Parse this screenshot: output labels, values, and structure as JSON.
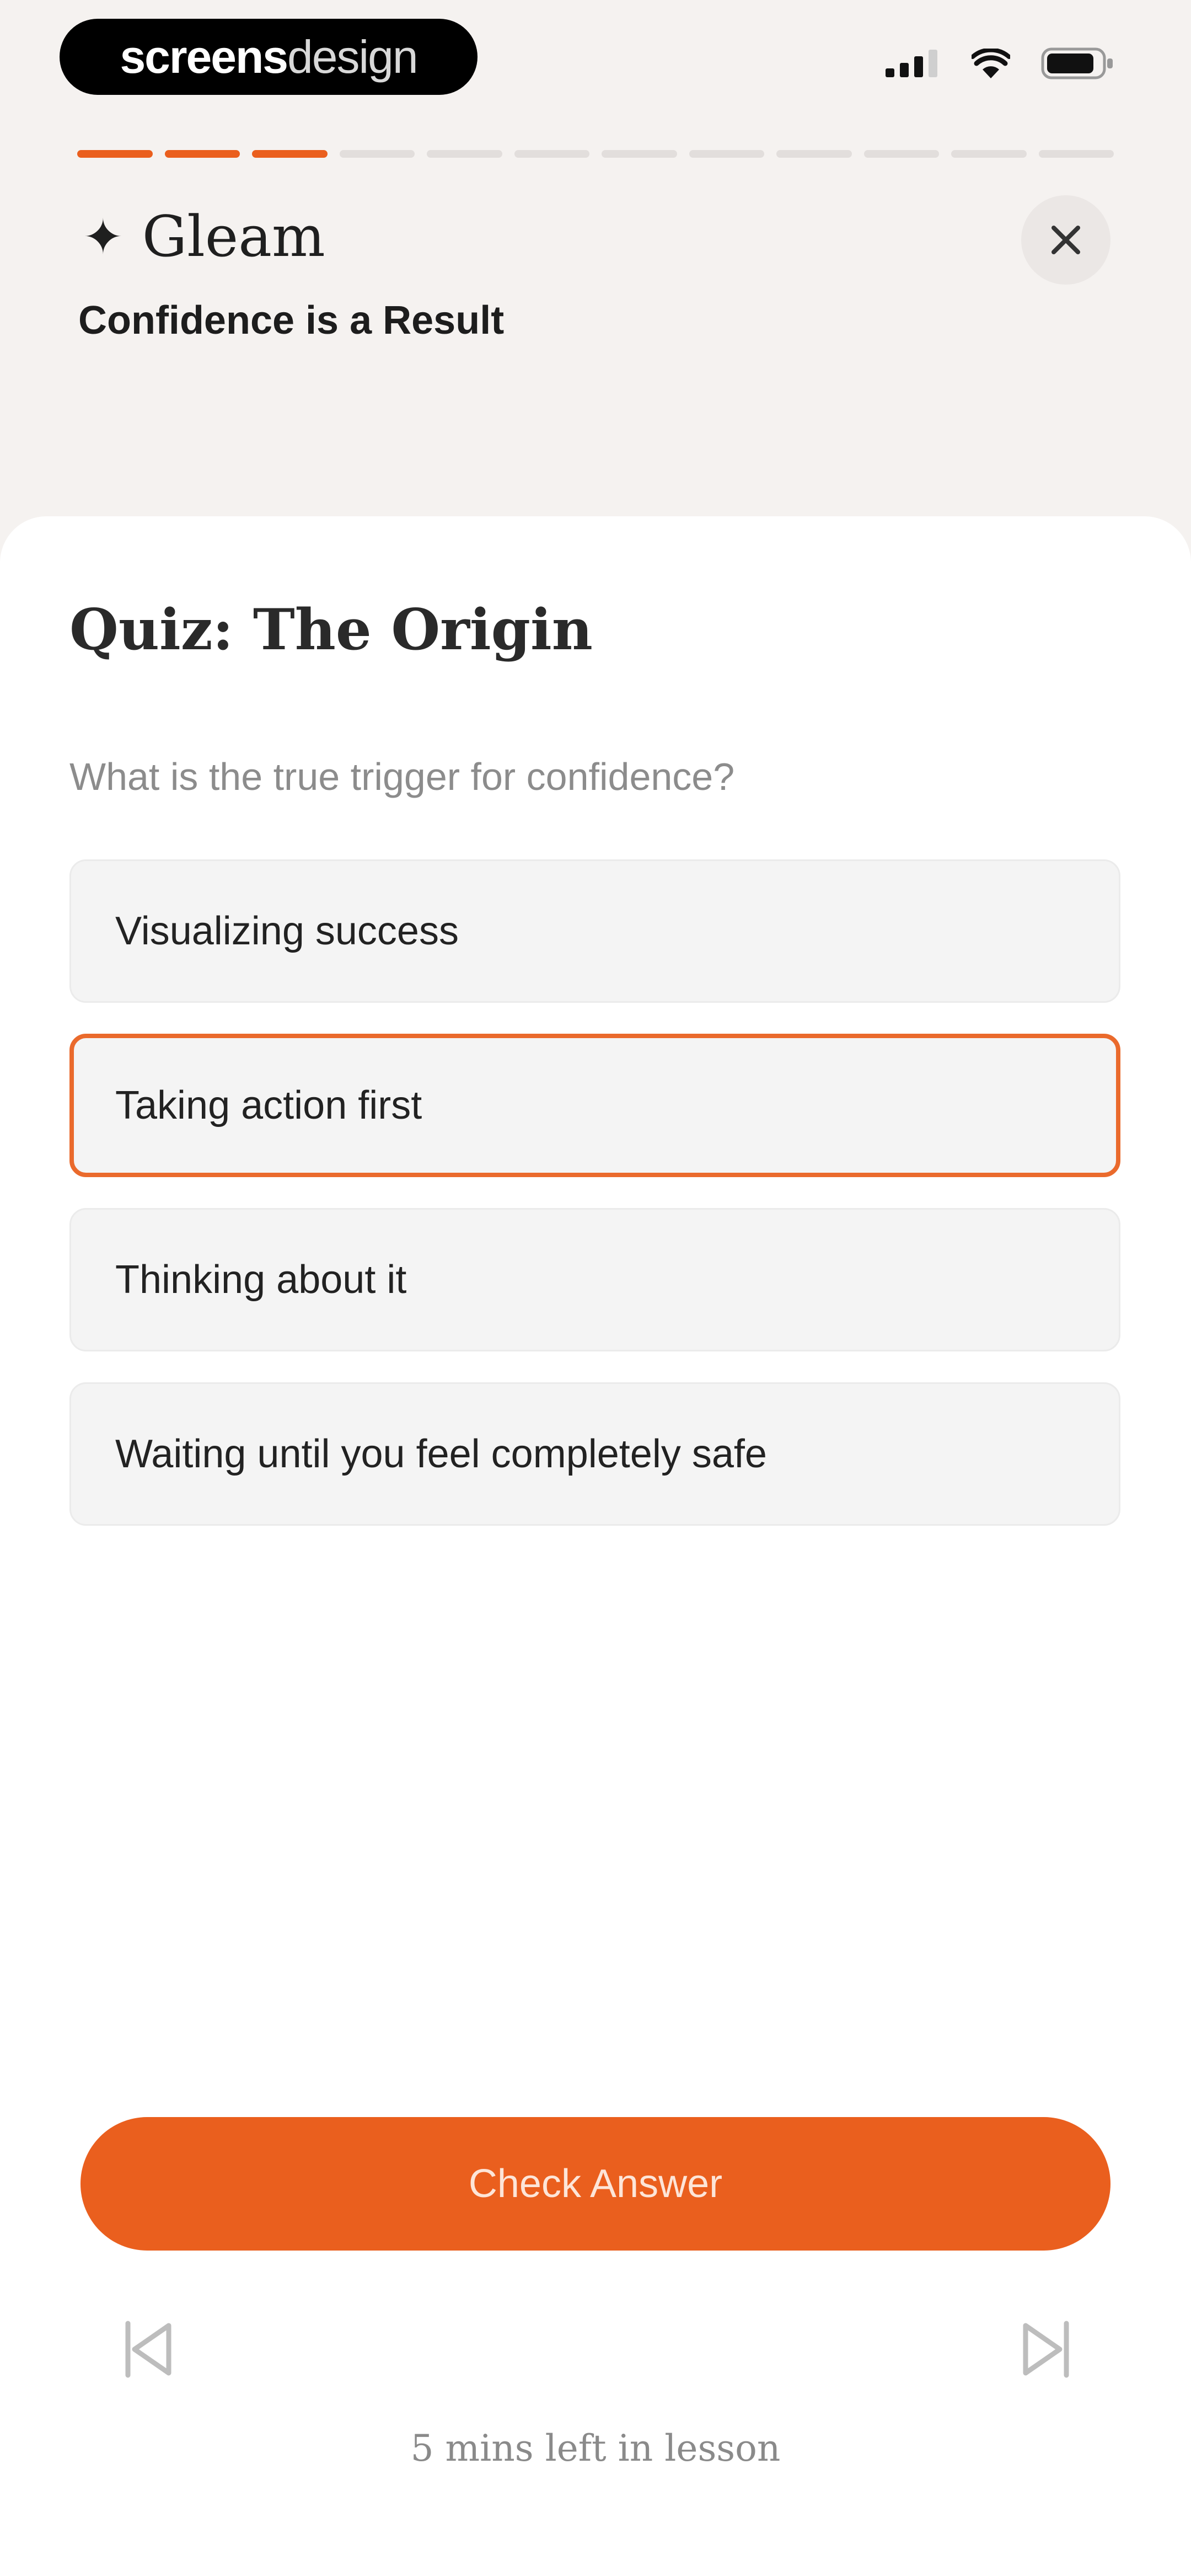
{
  "status_bar": {
    "brand_bold": "screens",
    "brand_light": "design"
  },
  "progress": {
    "completed": 3,
    "total": 12
  },
  "header": {
    "app_name": "Gleam",
    "lesson_title": "Confidence is a Result"
  },
  "quiz": {
    "title": "Quiz: The Origin",
    "question": "What is the true trigger for confidence?",
    "options": [
      "Visualizing success",
      "Taking action first",
      "Thinking about it",
      "Waiting until you feel completely safe"
    ],
    "selected_option": "Taking action first"
  },
  "actions": {
    "check_answer_label": "Check Answer"
  },
  "footer": {
    "time_left": "5 mins left in lesson"
  },
  "icons": {
    "sparkle": "sparkle-icon",
    "close": "close-icon",
    "prev": "skip-previous-icon",
    "next": "skip-next-icon",
    "signal": "signal-icon",
    "wifi": "wifi-icon",
    "battery": "battery-icon"
  },
  "colors": {
    "accent": "#ea5f1e",
    "selected_border": "#ea6a2c",
    "background": "#f5f2f0"
  }
}
